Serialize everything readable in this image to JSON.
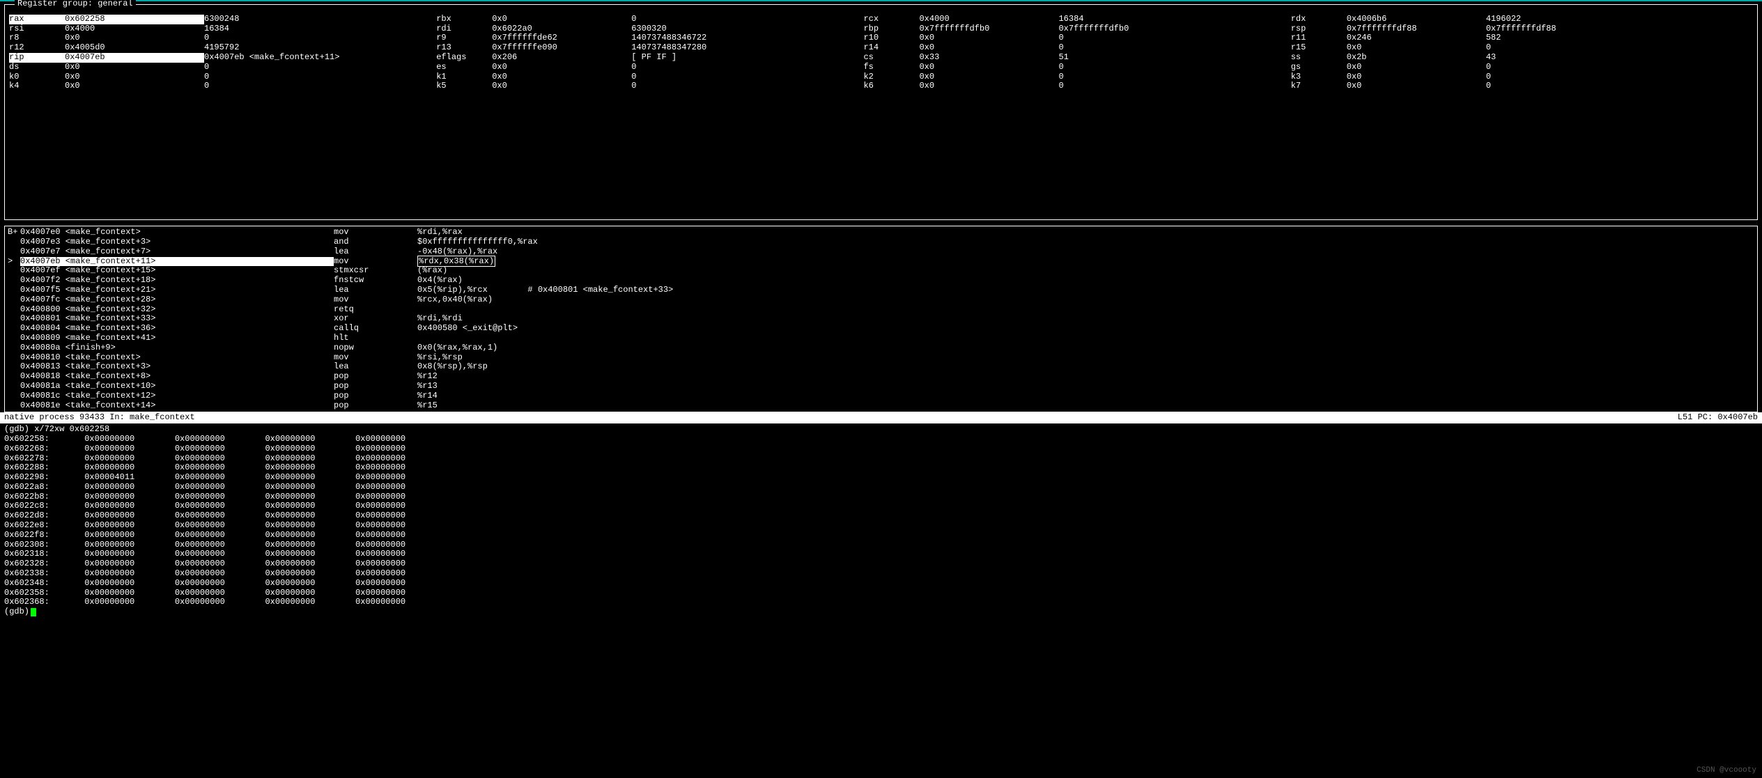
{
  "register_panel": {
    "title": "Register group: general",
    "rows": [
      [
        {
          "name": "rax",
          "hex": "0x602258",
          "dec": "6300248",
          "hl": true
        },
        {
          "name": "rbx",
          "hex": "0x0",
          "dec": "0"
        },
        {
          "name": "rcx",
          "hex": "0x4000",
          "dec": "16384"
        },
        {
          "name": "rdx",
          "hex": "0x4006b6",
          "dec": "4196022"
        }
      ],
      [
        {
          "name": "rsi",
          "hex": "0x4000",
          "dec": "16384"
        },
        {
          "name": "rdi",
          "hex": "0x6022a0",
          "dec": "6300320"
        },
        {
          "name": "rbp",
          "hex": "0x7fffffffdfb0",
          "dec": "0x7fffffffdfb0"
        },
        {
          "name": "rsp",
          "hex": "0x7fffffffdf88",
          "dec": "0x7fffffffdf88"
        }
      ],
      [
        {
          "name": "r8",
          "hex": "0x0",
          "dec": "0"
        },
        {
          "name": "r9",
          "hex": "0x7ffffffde62",
          "dec": "140737488346722"
        },
        {
          "name": "r10",
          "hex": "0x0",
          "dec": "0"
        },
        {
          "name": "r11",
          "hex": "0x246",
          "dec": "582"
        }
      ],
      [
        {
          "name": "r12",
          "hex": "0x4005d0",
          "dec": "4195792"
        },
        {
          "name": "r13",
          "hex": "0x7ffffffe090",
          "dec": "140737488347280"
        },
        {
          "name": "r14",
          "hex": "0x0",
          "dec": "0"
        },
        {
          "name": "r15",
          "hex": "0x0",
          "dec": "0"
        }
      ],
      [
        {
          "name": "rip",
          "hex": "0x4007eb",
          "dec": "0x4007eb <make_fcontext+11>",
          "hl": true
        },
        {
          "name": "eflags",
          "hex": "0x206",
          "dec": "[ PF IF ]"
        },
        {
          "name": "cs",
          "hex": "0x33",
          "dec": "51"
        },
        {
          "name": "ss",
          "hex": "0x2b",
          "dec": "43"
        }
      ],
      [
        {
          "name": "ds",
          "hex": "0x0",
          "dec": "0"
        },
        {
          "name": "es",
          "hex": "0x0",
          "dec": "0"
        },
        {
          "name": "fs",
          "hex": "0x0",
          "dec": "0"
        },
        {
          "name": "gs",
          "hex": "0x0",
          "dec": "0"
        }
      ],
      [
        {
          "name": "k0",
          "hex": "0x0",
          "dec": "0"
        },
        {
          "name": "k1",
          "hex": "0x0",
          "dec": "0"
        },
        {
          "name": "k2",
          "hex": "0x0",
          "dec": "0"
        },
        {
          "name": "k3",
          "hex": "0x0",
          "dec": "0"
        }
      ],
      [
        {
          "name": "k4",
          "hex": "0x0",
          "dec": "0"
        },
        {
          "name": "k5",
          "hex": "0x0",
          "dec": "0"
        },
        {
          "name": "k6",
          "hex": "0x0",
          "dec": "0"
        },
        {
          "name": "k7",
          "hex": "0x0",
          "dec": "0"
        }
      ]
    ]
  },
  "asm_panel": {
    "bp_marker": "B+",
    "lines": [
      {
        "gutter": "",
        "addr": "0x4007e0 <make_fcontext>",
        "op": "mov",
        "args": "%rdi,%rax"
      },
      {
        "gutter": "",
        "addr": "0x4007e3 <make_fcontext+3>",
        "op": "and",
        "args": "$0xfffffffffffffff0,%rax"
      },
      {
        "gutter": "",
        "addr": "0x4007e7 <make_fcontext+7>",
        "op": "lea",
        "args": "-0x48(%rax),%rax"
      },
      {
        "gutter": ">",
        "addr": "0x4007eb <make_fcontext+11>",
        "op": "mov",
        "args": "%rdx,0x38(%rax)",
        "current": true,
        "box_args": true
      },
      {
        "gutter": "",
        "addr": "0x4007ef <make_fcontext+15>",
        "op": "stmxcsr",
        "args": "(%rax)"
      },
      {
        "gutter": "",
        "addr": "0x4007f2 <make_fcontext+18>",
        "op": "fnstcw",
        "args": "0x4(%rax)"
      },
      {
        "gutter": "",
        "addr": "0x4007f5 <make_fcontext+21>",
        "op": "lea",
        "args": "0x5(%rip),%rcx        # 0x400801 <make_fcontext+33>"
      },
      {
        "gutter": "",
        "addr": "0x4007fc <make_fcontext+28>",
        "op": "mov",
        "args": "%rcx,0x40(%rax)"
      },
      {
        "gutter": "",
        "addr": "0x400800 <make_fcontext+32>",
        "op": "retq",
        "args": ""
      },
      {
        "gutter": "",
        "addr": "0x400801 <make_fcontext+33>",
        "op": "xor",
        "args": "%rdi,%rdi"
      },
      {
        "gutter": "",
        "addr": "0x400804 <make_fcontext+36>",
        "op": "callq",
        "args": "0x400580 <_exit@plt>"
      },
      {
        "gutter": "",
        "addr": "0x400809 <make_fcontext+41>",
        "op": "hlt",
        "args": ""
      },
      {
        "gutter": "",
        "addr": "0x40080a <finish+9>",
        "op": "nopw",
        "args": "0x0(%rax,%rax,1)"
      },
      {
        "gutter": "",
        "addr": "0x400810 <take_fcontext>",
        "op": "mov",
        "args": "%rsi,%rsp"
      },
      {
        "gutter": "",
        "addr": "0x400813 <take_fcontext+3>",
        "op": "lea",
        "args": "0x8(%rsp),%rsp"
      },
      {
        "gutter": "",
        "addr": "0x400818 <take_fcontext+8>",
        "op": "pop",
        "args": "%r12"
      },
      {
        "gutter": "",
        "addr": "0x40081a <take_fcontext+10>",
        "op": "pop",
        "args": "%r13"
      },
      {
        "gutter": "",
        "addr": "0x40081c <take_fcontext+12>",
        "op": "pop",
        "args": "%r14"
      },
      {
        "gutter": "",
        "addr": "0x40081e <take_fcontext+14>",
        "op": "pop",
        "args": "%r15"
      }
    ]
  },
  "status_bar": {
    "left": "native process 93433 In: make_fcontext",
    "right": "L51   PC: 0x4007eb"
  },
  "gdb_output": {
    "cmd": "(gdb) x/72xw 0x602258",
    "rows": [
      {
        "addr": "0x602258:",
        "v": [
          "0x00000000",
          "0x00000000",
          "0x00000000",
          "0x00000000"
        ]
      },
      {
        "addr": "0x602268:",
        "v": [
          "0x00000000",
          "0x00000000",
          "0x00000000",
          "0x00000000"
        ]
      },
      {
        "addr": "0x602278:",
        "v": [
          "0x00000000",
          "0x00000000",
          "0x00000000",
          "0x00000000"
        ]
      },
      {
        "addr": "0x602288:",
        "v": [
          "0x00000000",
          "0x00000000",
          "0x00000000",
          "0x00000000"
        ]
      },
      {
        "addr": "0x602298:",
        "v": [
          "0x00004011",
          "0x00000000",
          "0x00000000",
          "0x00000000"
        ]
      },
      {
        "addr": "0x6022a8:",
        "v": [
          "0x00000000",
          "0x00000000",
          "0x00000000",
          "0x00000000"
        ]
      },
      {
        "addr": "0x6022b8:",
        "v": [
          "0x00000000",
          "0x00000000",
          "0x00000000",
          "0x00000000"
        ]
      },
      {
        "addr": "0x6022c8:",
        "v": [
          "0x00000000",
          "0x00000000",
          "0x00000000",
          "0x00000000"
        ]
      },
      {
        "addr": "0x6022d8:",
        "v": [
          "0x00000000",
          "0x00000000",
          "0x00000000",
          "0x00000000"
        ]
      },
      {
        "addr": "0x6022e8:",
        "v": [
          "0x00000000",
          "0x00000000",
          "0x00000000",
          "0x00000000"
        ]
      },
      {
        "addr": "0x6022f8:",
        "v": [
          "0x00000000",
          "0x00000000",
          "0x00000000",
          "0x00000000"
        ]
      },
      {
        "addr": "0x602308:",
        "v": [
          "0x00000000",
          "0x00000000",
          "0x00000000",
          "0x00000000"
        ]
      },
      {
        "addr": "0x602318:",
        "v": [
          "0x00000000",
          "0x00000000",
          "0x00000000",
          "0x00000000"
        ]
      },
      {
        "addr": "0x602328:",
        "v": [
          "0x00000000",
          "0x00000000",
          "0x00000000",
          "0x00000000"
        ]
      },
      {
        "addr": "0x602338:",
        "v": [
          "0x00000000",
          "0x00000000",
          "0x00000000",
          "0x00000000"
        ]
      },
      {
        "addr": "0x602348:",
        "v": [
          "0x00000000",
          "0x00000000",
          "0x00000000",
          "0x00000000"
        ]
      },
      {
        "addr": "0x602358:",
        "v": [
          "0x00000000",
          "0x00000000",
          "0x00000000",
          "0x00000000"
        ]
      },
      {
        "addr": "0x602368:",
        "v": [
          "0x00000000",
          "0x00000000",
          "0x00000000",
          "0x00000000"
        ]
      }
    ],
    "prompt": "(gdb) "
  },
  "watermark": "CSDN @vcoooty"
}
